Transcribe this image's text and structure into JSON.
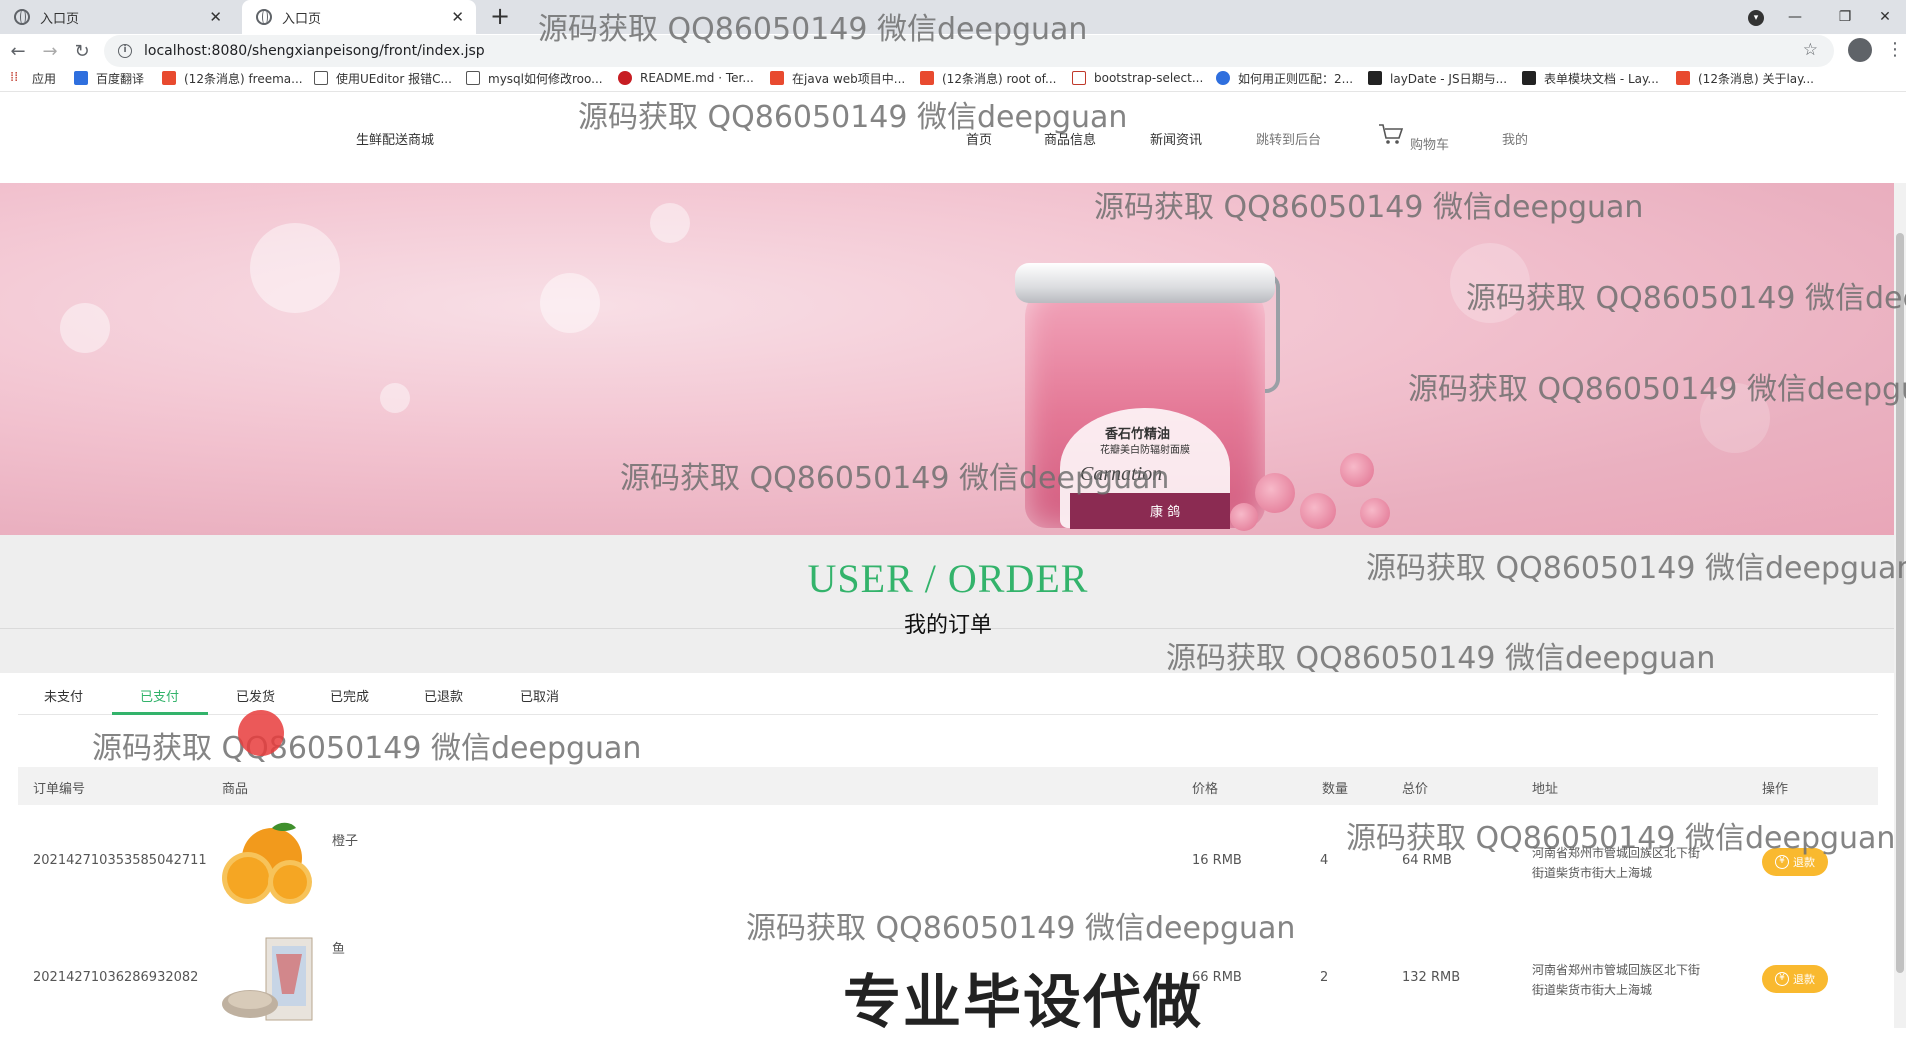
{
  "browser": {
    "tabs": [
      {
        "label": "入口页",
        "active": false
      },
      {
        "label": "入口页",
        "active": true
      }
    ],
    "url": "localhost:8080/shengxianpeisong/front/index.jsp",
    "bookmarks": [
      {
        "label": "应用",
        "icon": "apps-grid-icon",
        "color": "#c0392b"
      },
      {
        "label": "百度翻译",
        "icon": "translate-icon",
        "color": "#2f6fde"
      },
      {
        "label": "(12条消息) freema...",
        "icon": "csdn-icon",
        "color": "#e84a2f"
      },
      {
        "label": "使用UEditor 报错C...",
        "icon": "bookmark-icon",
        "color": "#555555"
      },
      {
        "label": "mysql如何修改roo...",
        "icon": "bookmark-icon",
        "color": "#555555"
      },
      {
        "label": "README.md · Ter...",
        "icon": "gitee-icon",
        "color": "#c71d23"
      },
      {
        "label": "在java web项目中...",
        "icon": "csdn-icon",
        "color": "#e84a2f"
      },
      {
        "label": "(12条消息) root of...",
        "icon": "csdn-icon",
        "color": "#e84a2f"
      },
      {
        "label": "bootstrap-select...",
        "icon": "bookmark-icon",
        "color": "#c0392b"
      },
      {
        "label": "如何用正则匹配：2...",
        "icon": "baidu-icon",
        "color": "#2f6fde"
      },
      {
        "label": "layDate - JS日期与...",
        "icon": "layui-icon",
        "color": "#222222"
      },
      {
        "label": "表单模块文档 - Lay...",
        "icon": "layui-icon",
        "color": "#222222"
      },
      {
        "label": "(12条消息) 关于lay...",
        "icon": "csdn-icon",
        "color": "#e84a2f"
      }
    ]
  },
  "site": {
    "brand": "生鲜配送商城",
    "nav": [
      {
        "label": "首页"
      },
      {
        "label": "商品信息"
      },
      {
        "label": "新闻资讯"
      },
      {
        "label": "跳转到后台"
      },
      {
        "label": "购物车",
        "icon": "cart-icon"
      },
      {
        "label": "我的"
      }
    ]
  },
  "banner": {
    "product_text": "香石竹精油",
    "product_subtext": "花瓣美白防辐射面膜",
    "brand_text": "Carnation",
    "base_text": "康 鸽"
  },
  "section": {
    "title_en": "USER / ORDER",
    "title_cn": "我的订单"
  },
  "order_tabs": [
    {
      "label": "未支付",
      "active": false
    },
    {
      "label": "已支付",
      "active": true
    },
    {
      "label": "已发货",
      "active": false
    },
    {
      "label": "已完成",
      "active": false
    },
    {
      "label": "已退款",
      "active": false
    },
    {
      "label": "已取消",
      "active": false
    }
  ],
  "table": {
    "headers": [
      "订单编号",
      "商品",
      "价格",
      "数量",
      "总价",
      "地址",
      "操作"
    ],
    "rows": [
      {
        "order_no": "20214271035358504271​1",
        "product": "橙子",
        "price": "16 RMB",
        "qty": "4",
        "total": "64 RMB",
        "address_line1": "河南省郑州市管城回族区北下街",
        "address_line2": "街道柴货市街大上海城",
        "action": "退款"
      },
      {
        "order_no": "20214271036286932082",
        "product": "鱼",
        "price": "66 RMB",
        "qty": "2",
        "total": "132 RMB",
        "address_line1": "河南省郑州市管城回族区北下街",
        "address_line2": "街道柴货市街大上海城",
        "action": "退款"
      }
    ]
  },
  "overlays": {
    "watermark": "源码获取 QQ86050149 微信deepguan",
    "watermark_cut1": "源码获取 QQ86050149 微信dee",
    "watermark_cut2": "源码获取 QQ86050149 微信deepgu",
    "big_text": "专业毕设代做"
  },
  "colors": {
    "accent_green": "#33b36b",
    "refund_orange": "#f9b92f"
  }
}
